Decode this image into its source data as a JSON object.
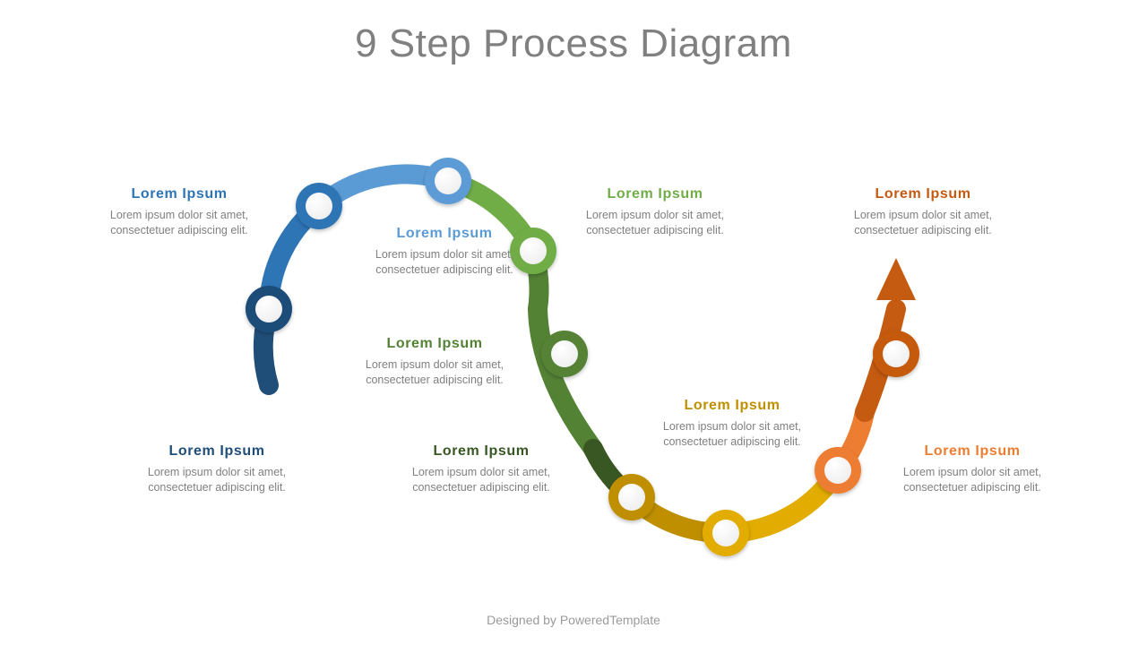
{
  "title": "9 Step Process Diagram",
  "footer": "Designed by PoweredTemplate",
  "common_body": "Lorem ipsum dolor sit amet, consectetuer adipiscing elit.",
  "steps": [
    {
      "heading": "Lorem  Ipsum",
      "color": "#1F4E79"
    },
    {
      "heading": "Lorem  Ipsum",
      "color": "#2E75B6"
    },
    {
      "heading": "Lorem  Ipsum",
      "color": "#5B9BD5"
    },
    {
      "heading": "Lorem  Ipsum",
      "color": "#70AD47"
    },
    {
      "heading": "Lorem  Ipsum",
      "color": "#548235"
    },
    {
      "heading": "Lorem  Ipsum",
      "color": "#385723"
    },
    {
      "heading": "Lorem  Ipsum",
      "color": "#BF8F00"
    },
    {
      "heading": "Lorem  Ipsum",
      "color": "#ED7D31"
    },
    {
      "heading": "Lorem  Ipsum",
      "color": "#C55A11"
    }
  ]
}
